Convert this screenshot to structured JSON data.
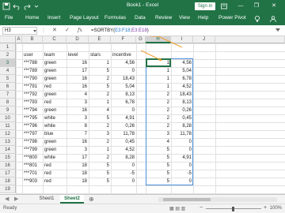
{
  "window": {
    "title": "Book1 - Excel",
    "signin_label": "Sign in",
    "minimize_glyph": "—",
    "restore_glyph": "❐",
    "close_glyph": "✕",
    "qat_icons": [
      "save-icon",
      "undo-icon",
      "redo-icon",
      "customize-icon"
    ]
  },
  "ribbon": {
    "tabs": [
      "File",
      "Home",
      "Insert",
      "Page Layout",
      "Formulas",
      "Data",
      "Review",
      "View",
      "Help",
      "Power Pivot"
    ]
  },
  "formula_bar": {
    "name_box": "H3",
    "cancel_glyph": "✕",
    "enter_glyph": "✓",
    "fx_label": "fx",
    "formula_prefix": "=SORTBY(",
    "formula_ref1": "E3:F18",
    "formula_sep1": ";",
    "formula_ref2": "E3:E18",
    "formula_suffix": ")"
  },
  "sheet": {
    "columns": [
      "A",
      "B",
      "C",
      "D",
      "E",
      "F",
      "G",
      "H",
      "I",
      "J"
    ],
    "selected_column": "H",
    "rows": [
      "1",
      "2",
      "3",
      "4",
      "5",
      "6",
      "7",
      "8",
      "9",
      "10",
      "11",
      "12",
      "13",
      "14",
      "15",
      "16",
      "17",
      "18",
      "19"
    ],
    "headers": {
      "user": "user",
      "team": "team",
      "level": "level",
      "stars": "stars",
      "incentive": "incentive"
    },
    "data": [
      [
        "***788",
        "green",
        "16",
        "1",
        "4,56",
        "1",
        "4,56"
      ],
      [
        "***789",
        "green",
        "17",
        "5",
        "0",
        "1",
        "5,04"
      ],
      [
        "***790",
        "green",
        "16",
        "2",
        "18,43",
        "1",
        "6,78"
      ],
      [
        "***791",
        "red",
        "16",
        "5",
        "5,04",
        "1",
        "4,52"
      ],
      [
        "***792",
        "green",
        "4",
        "2",
        "8,13",
        "2",
        "18,43"
      ],
      [
        "***793",
        "red",
        "3",
        "1",
        "6,78",
        "2",
        "8,13"
      ],
      [
        "***794",
        "green",
        "16",
        "4",
        "0",
        "2",
        "0,26"
      ],
      [
        "***795",
        "white",
        "3",
        "5",
        "4,91",
        "2",
        "0,45"
      ],
      [
        "***796",
        "white",
        "8",
        "2",
        "0,26",
        "2",
        "8,28"
      ],
      [
        "***797",
        "blue",
        "7",
        "3",
        "11,78",
        "3",
        "11,78"
      ],
      [
        "***798",
        "green",
        "16",
        "2",
        "0,45",
        "4",
        "0"
      ],
      [
        "***799",
        "green",
        "3",
        "1",
        "4,52",
        "5",
        "0"
      ],
      [
        "***800",
        "white",
        "17",
        "2",
        "8,28",
        "5",
        "4,91"
      ],
      [
        "***801",
        "red",
        "18",
        "5",
        "0",
        "5",
        "0"
      ],
      [
        "***701",
        "red",
        "18",
        "5",
        "-5",
        "5",
        "-5"
      ],
      [
        "***903",
        "red",
        "18",
        "5",
        "0",
        "5",
        "0"
      ]
    ]
  },
  "sheet_tabs": {
    "prev_glyph": "◀",
    "next_glyph": "▶",
    "tabs": [
      "Sheet1",
      "Sheet2"
    ],
    "active": "Sheet2",
    "add_glyph": "⊕"
  },
  "status": {
    "ready": "Ready",
    "view_icons": "▦ ▤ ▥",
    "zoom_minus": "−",
    "zoom_plus": "+",
    "zoom": "100%"
  },
  "colors": {
    "excel_green": "#217346",
    "spill_blue": "#4a90d9",
    "arrow_orange": "#f0a030"
  }
}
